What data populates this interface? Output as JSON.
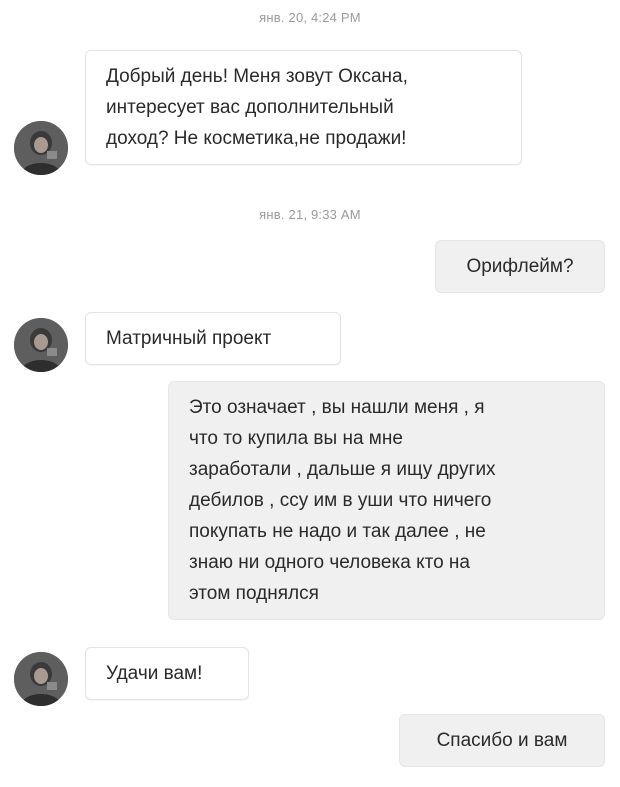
{
  "conversation": {
    "messages": [
      {
        "kind": "timestamp",
        "text": "янв. 20, 4:24 PM"
      },
      {
        "kind": "incoming",
        "lines": [
          "Добрый день! Меня зовут Оксана,",
          "интересует вас дополнительный",
          "доход? Не косметика,не продажи!"
        ]
      },
      {
        "kind": "timestamp",
        "text": "янв. 21, 9:33 AM"
      },
      {
        "kind": "outgoing",
        "lines": [
          "Орифлейм?"
        ]
      },
      {
        "kind": "incoming",
        "lines": [
          "Матричный проект"
        ]
      },
      {
        "kind": "outgoing",
        "lines": [
          "Это означает , вы нашли меня , я",
          "что то купила вы на мне",
          "заработали , дальше я ищу других",
          "дебилов , ссу им в уши что ничего",
          "покупать не надо и так далее , не",
          "знаю ни одного человека кто на",
          "этом поднялся"
        ]
      },
      {
        "kind": "incoming",
        "lines": [
          "Удачи вам!"
        ]
      },
      {
        "kind": "outgoing",
        "lines": [
          "Спасибо и вам"
        ]
      }
    ]
  },
  "colors": {
    "incoming_bubble": "#ffffff",
    "outgoing_bubble": "#f0f0f0",
    "timestamp_text": "#9a9a9a",
    "message_text": "#2a2a2a"
  },
  "icons": {
    "avatar": "contact-avatar-photo"
  }
}
